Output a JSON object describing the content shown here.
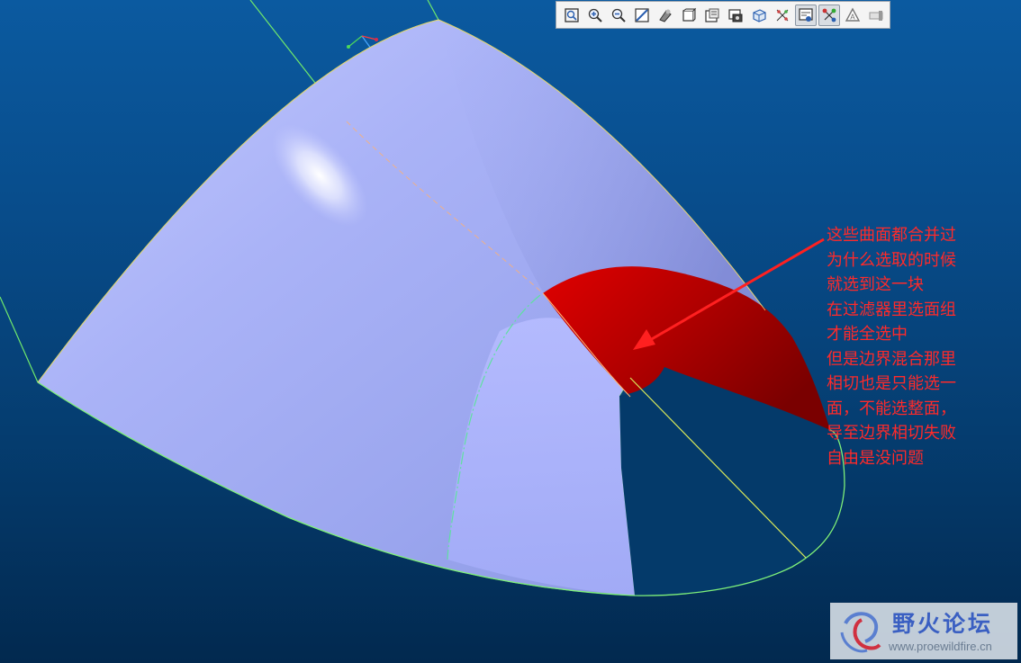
{
  "toolbar": {
    "buttons": [
      {
        "name": "refit-icon",
        "pressed": false
      },
      {
        "name": "zoom-in-icon",
        "pressed": false
      },
      {
        "name": "zoom-out-icon",
        "pressed": false
      },
      {
        "name": "repaint-icon",
        "pressed": false
      },
      {
        "name": "shading-icon",
        "pressed": false
      },
      {
        "name": "saved-views-icon",
        "pressed": false
      },
      {
        "name": "view-manager-icon",
        "pressed": false
      },
      {
        "name": "layers-icon",
        "pressed": false
      },
      {
        "name": "orient-icon",
        "pressed": false
      },
      {
        "name": "datum-points-icon",
        "pressed": false
      },
      {
        "name": "display-style-icon",
        "pressed": true
      },
      {
        "name": "datum-display-icon",
        "pressed": true
      },
      {
        "name": "annotation-display-icon",
        "pressed": false
      },
      {
        "name": "spin-center-icon",
        "pressed": false
      }
    ]
  },
  "model": {
    "surface_color": "#a6b1f5",
    "selected_surface_color": "#d40000",
    "edge_color": "#7ef07a",
    "background_top": "#0b5aa0",
    "background_bottom": "#02294f"
  },
  "annotation": {
    "color": "#ff2a2a",
    "lines": [
      "这些曲面都合并过",
      "为什么选取的时候",
      "就选到这一块",
      "在过滤器里选面组",
      "才能全选中",
      "但是边界混合那里",
      "相切也是只能选一",
      "面，不能选整面，",
      "导至边界相切失败",
      "自由是没问题"
    ]
  },
  "watermark": {
    "title": "野火论坛",
    "url": "www.proewildfire.cn"
  }
}
